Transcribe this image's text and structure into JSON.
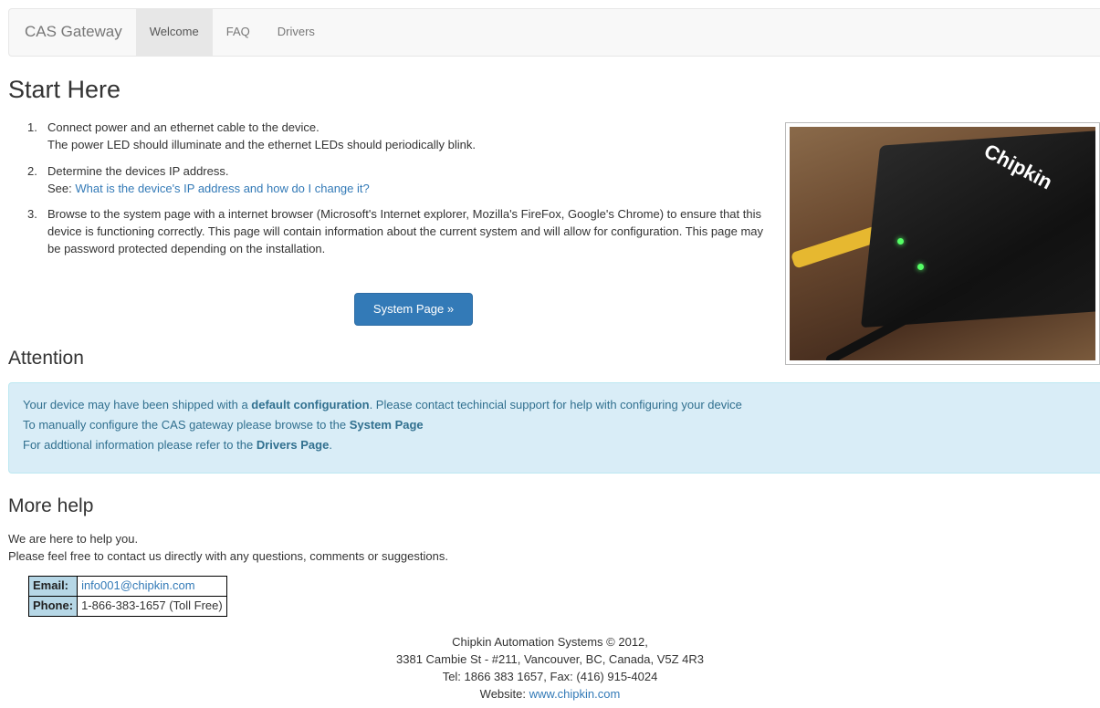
{
  "navbar": {
    "brand": "CAS Gateway",
    "items": [
      {
        "label": "Welcome",
        "active": true
      },
      {
        "label": "FAQ",
        "active": false
      },
      {
        "label": "Drivers",
        "active": false
      }
    ]
  },
  "start": {
    "title": "Start Here",
    "steps": [
      {
        "num": "1.",
        "line1": "Connect power and an ethernet cable to the device.",
        "line2": "The power LED should illuminate and the ethernet LEDs should periodically blink."
      },
      {
        "num": "2.",
        "line1": "Determine the devices IP address.",
        "see_prefix": "See: ",
        "link": "What is the device's IP address and how do I change it?"
      },
      {
        "num": "3.",
        "text": "Browse to the system page with a internet browser (Microsoft's Internet explorer, Mozilla's FireFox, Google's Chrome) to ensure that this device is functioning correctly. This page will contain information about the current system and will allow for configuration. This page may be password protected depending on the installation."
      }
    ],
    "button": "System Page »"
  },
  "photo": {
    "logo": "Chipkin"
  },
  "attention": {
    "title": "Attention",
    "line1_a": "Your device may have been shipped with a ",
    "line1_b": "default configuration",
    "line1_c": ". Please contact techincial support for help with configuring your device",
    "line2_a": "To manually configure the CAS gateway please browse to the ",
    "line2_b": "System Page",
    "line3_a": "For addtional information please refer to the ",
    "line3_b": "Drivers Page",
    "line3_c": "."
  },
  "help": {
    "title": "More help",
    "line1": "We are here to help you.",
    "line2": "Please feel free to contact us directly with any questions, comments or suggestions.",
    "email_label": "Email:",
    "email": "info001@chipkin.com",
    "phone_label": "Phone:",
    "phone": "1-866-383-1657 (Toll Free)"
  },
  "footer": {
    "line1": "Chipkin Automation Systems © 2012,",
    "line2": "3381 Cambie St - #211, Vancouver, BC, Canada, V5Z 4R3",
    "line3": "Tel: 1866 383 1657, Fax: (416) 915-4024",
    "website_prefix": "Website: ",
    "website": "www.chipkin.com"
  },
  "colors": {
    "primary": "#337ab7",
    "alert_bg": "#d9edf7",
    "alert_text": "#31708f",
    "label_bg": "#b6d7e6"
  }
}
